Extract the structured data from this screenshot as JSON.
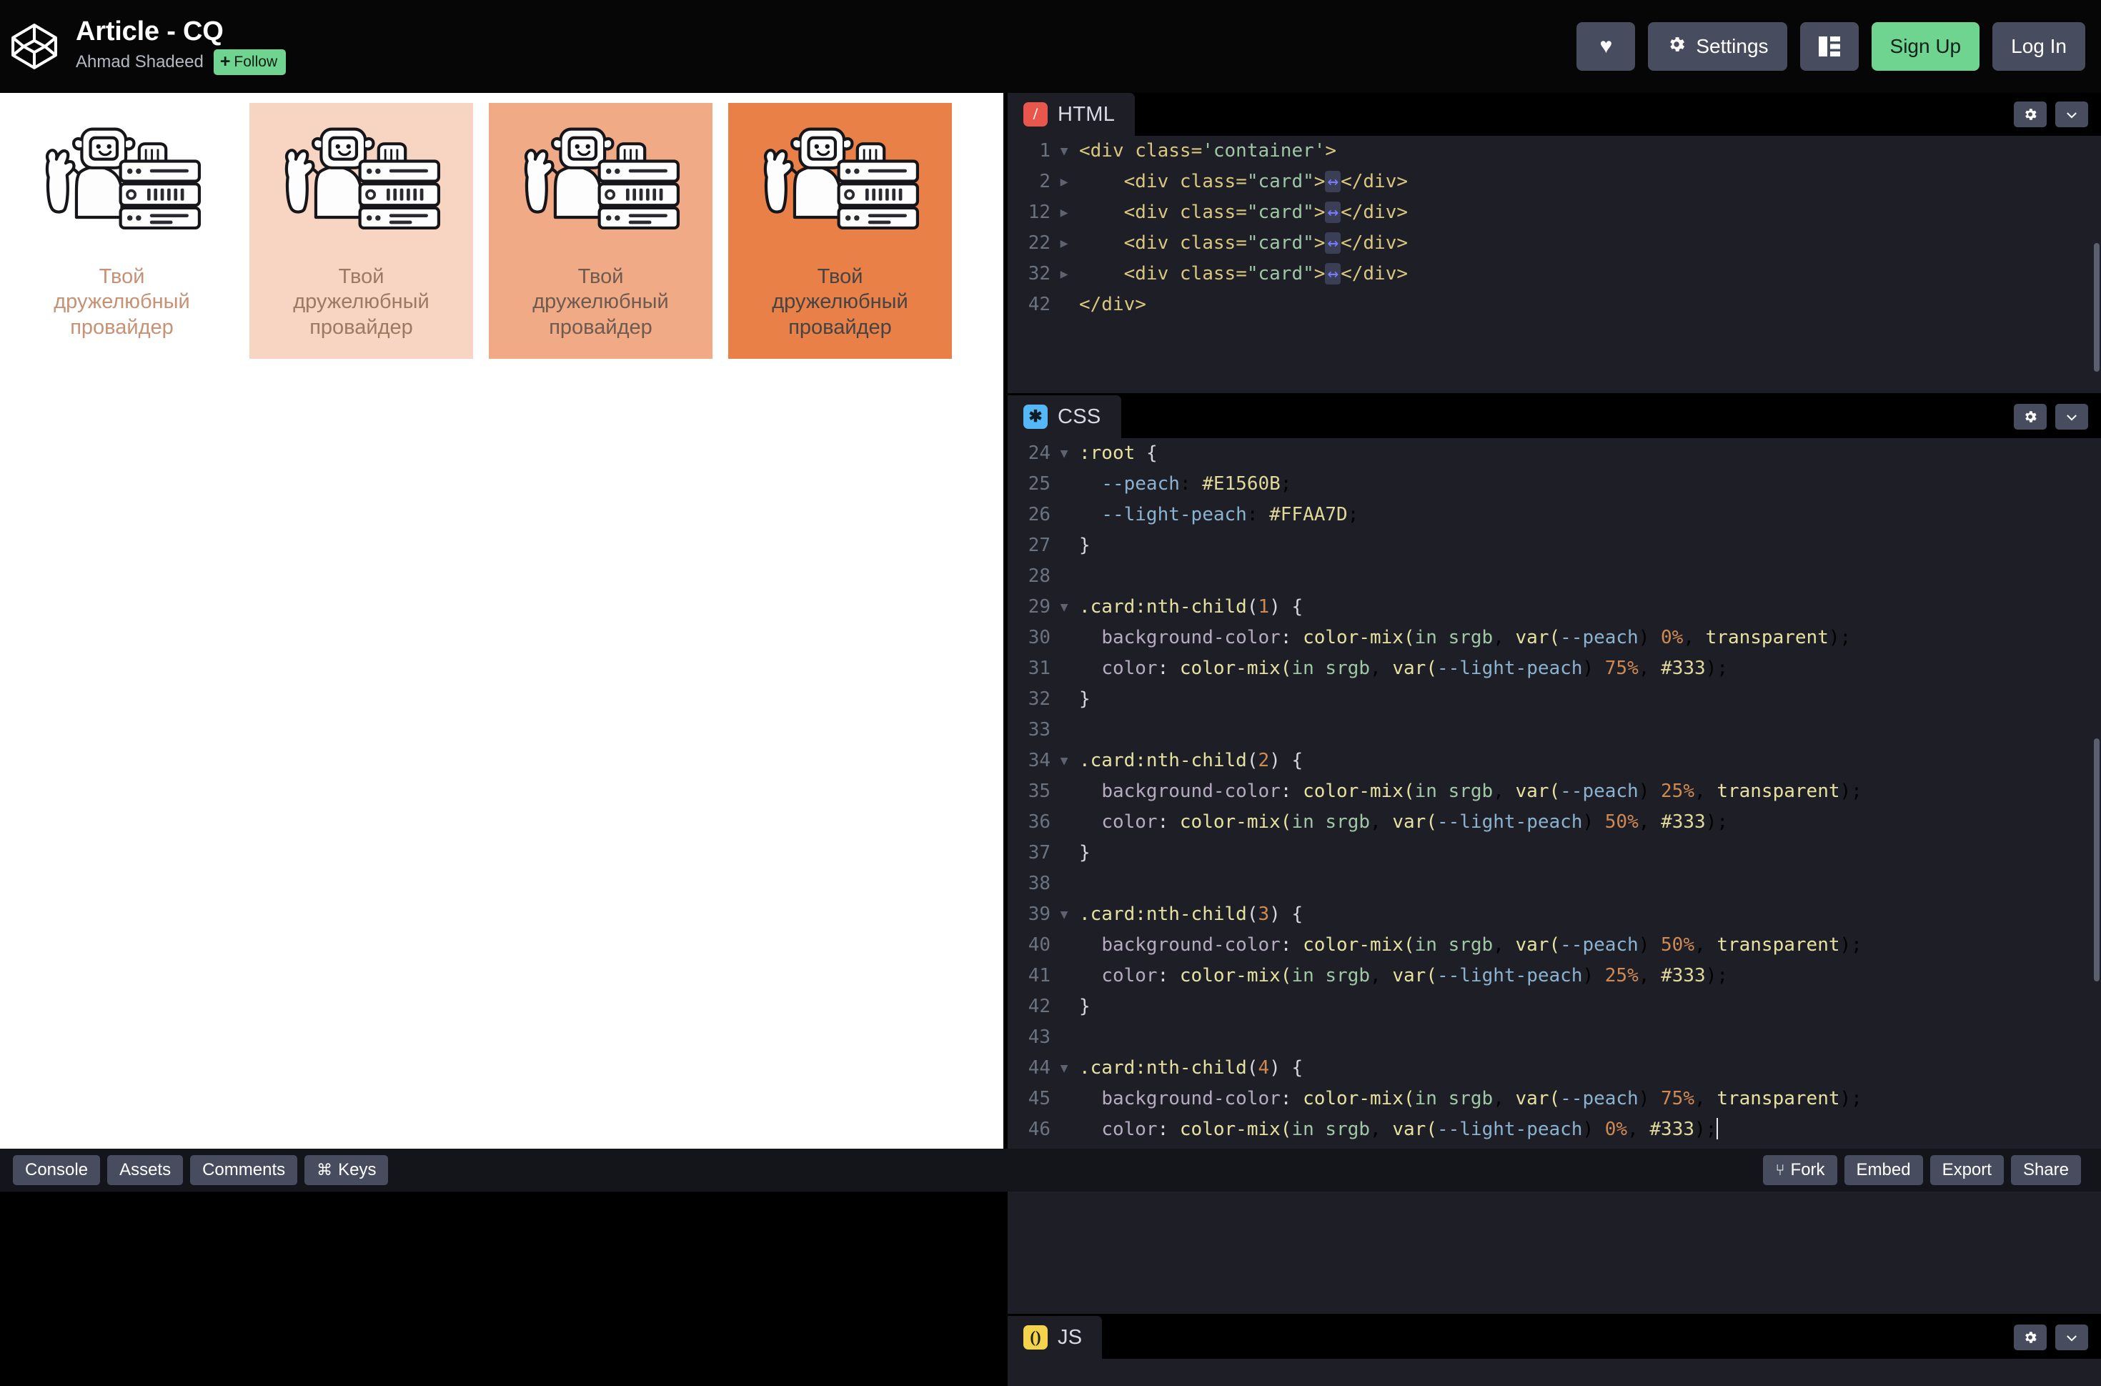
{
  "header": {
    "logo_icon": "codepen-logo-icon",
    "pen_title": "Article - CQ",
    "author": "Ahmad Shadeed",
    "follow_label": "Follow",
    "follow_plus": "+",
    "actions": {
      "heart_icon": "heart-icon",
      "heart_glyph": "♥",
      "settings_label": "Settings",
      "settings_icon": "gear-icon",
      "layout_icon": "layout-panels-icon",
      "signup_label": "Sign Up",
      "login_label": "Log In"
    }
  },
  "preview": {
    "cards": [
      {
        "caption": "Твой\nдружелюбный\nпровайдер",
        "bg": "rgba(225,86,11,0)",
        "text_color": "#c89173"
      },
      {
        "caption": "Твой\nдружелюбный\nпровайдер",
        "bg": "rgba(225,86,11,0.25)",
        "text_color": "#9b7a63"
      },
      {
        "caption": "Твой\nдружелюбный\nпровайдер",
        "bg": "rgba(225,86,11,0.5)",
        "text_color": "#6e5b4f"
      },
      {
        "caption": "Твой\nдружелюбный\nпровайдер",
        "bg": "rgba(225,86,11,0.75)",
        "text_color": "#444444"
      }
    ],
    "illustration_name": "llama-waving-with-server-rack-illustration"
  },
  "panes": [
    {
      "id": "html",
      "label": "HTML",
      "chip": "/",
      "settings_icon": "gear-icon",
      "collapse_icon": "chevron-down-icon",
      "lines": [
        {
          "n": "1",
          "fold": "▼"
        },
        {
          "n": "2",
          "fold": "▶"
        },
        {
          "n": "12",
          "fold": "▶"
        },
        {
          "n": "22",
          "fold": "▶"
        },
        {
          "n": "32",
          "fold": "▶"
        },
        {
          "n": "42",
          "fold": ""
        }
      ],
      "source": [
        "<div class='container'>",
        "  <div class=\"card\">…</div>",
        "  <div class=\"card\">…</div>",
        "  <div class=\"card\">…</div>",
        "  <div class=\"card\">…</div>",
        "</div>"
      ]
    },
    {
      "id": "css",
      "label": "CSS",
      "chip": "✱",
      "settings_icon": "gear-icon",
      "collapse_icon": "chevron-down-icon",
      "lines": [
        {
          "n": "24",
          "fold": "▼"
        },
        {
          "n": "25",
          "fold": ""
        },
        {
          "n": "26",
          "fold": ""
        },
        {
          "n": "27",
          "fold": ""
        },
        {
          "n": "28",
          "fold": ""
        },
        {
          "n": "29",
          "fold": "▼"
        },
        {
          "n": "30",
          "fold": ""
        },
        {
          "n": "31",
          "fold": ""
        },
        {
          "n": "32",
          "fold": ""
        },
        {
          "n": "33",
          "fold": ""
        },
        {
          "n": "34",
          "fold": "▼"
        },
        {
          "n": "35",
          "fold": ""
        },
        {
          "n": "36",
          "fold": ""
        },
        {
          "n": "37",
          "fold": ""
        },
        {
          "n": "38",
          "fold": ""
        },
        {
          "n": "39",
          "fold": "▼"
        },
        {
          "n": "40",
          "fold": ""
        },
        {
          "n": "41",
          "fold": ""
        },
        {
          "n": "42",
          "fold": ""
        },
        {
          "n": "43",
          "fold": ""
        },
        {
          "n": "44",
          "fold": "▼"
        },
        {
          "n": "45",
          "fold": ""
        },
        {
          "n": "46",
          "fold": ""
        }
      ],
      "source": [
        ":root {",
        "  --peach: #E1560B;",
        "  --light-peach: #FFAA7D;",
        "}",
        "",
        ".card:nth-child(1) {",
        "  background-color: color-mix(in srgb, var(--peach) 0%, transparent);",
        "  color: color-mix(in srgb, var(--light-peach) 75%, #333);",
        "}",
        "",
        ".card:nth-child(2) {",
        "  background-color: color-mix(in srgb, var(--peach) 25%, transparent);",
        "  color: color-mix(in srgb, var(--light-peach) 50%, #333);",
        "}",
        "",
        ".card:nth-child(3) {",
        "  background-color: color-mix(in srgb, var(--peach) 50%, transparent);",
        "  color: color-mix(in srgb, var(--light-peach) 25%, #333);",
        "}",
        "",
        ".card:nth-child(4) {",
        "  background-color: color-mix(in srgb, var(--peach) 75%, transparent);",
        "  color: color-mix(in srgb, var(--light-peach) 0%, #333);"
      ],
      "variables": {
        "peach": "#E1560B",
        "light_peach": "#FFAA7D"
      }
    },
    {
      "id": "js",
      "label": "JS",
      "chip": "()",
      "settings_icon": "gear-icon",
      "collapse_icon": "chevron-down-icon",
      "lines": [],
      "source": []
    }
  ],
  "bottombar": {
    "left": [
      {
        "label": "Console",
        "glyph": ""
      },
      {
        "label": "Assets",
        "glyph": ""
      },
      {
        "label": "Comments",
        "glyph": ""
      },
      {
        "label": "Keys",
        "glyph": "⌘"
      }
    ],
    "right": [
      {
        "label": "Fork",
        "glyph": "⑂"
      },
      {
        "label": "Embed",
        "glyph": ""
      },
      {
        "label": "Export",
        "glyph": ""
      },
      {
        "label": "Share",
        "glyph": ""
      }
    ]
  }
}
